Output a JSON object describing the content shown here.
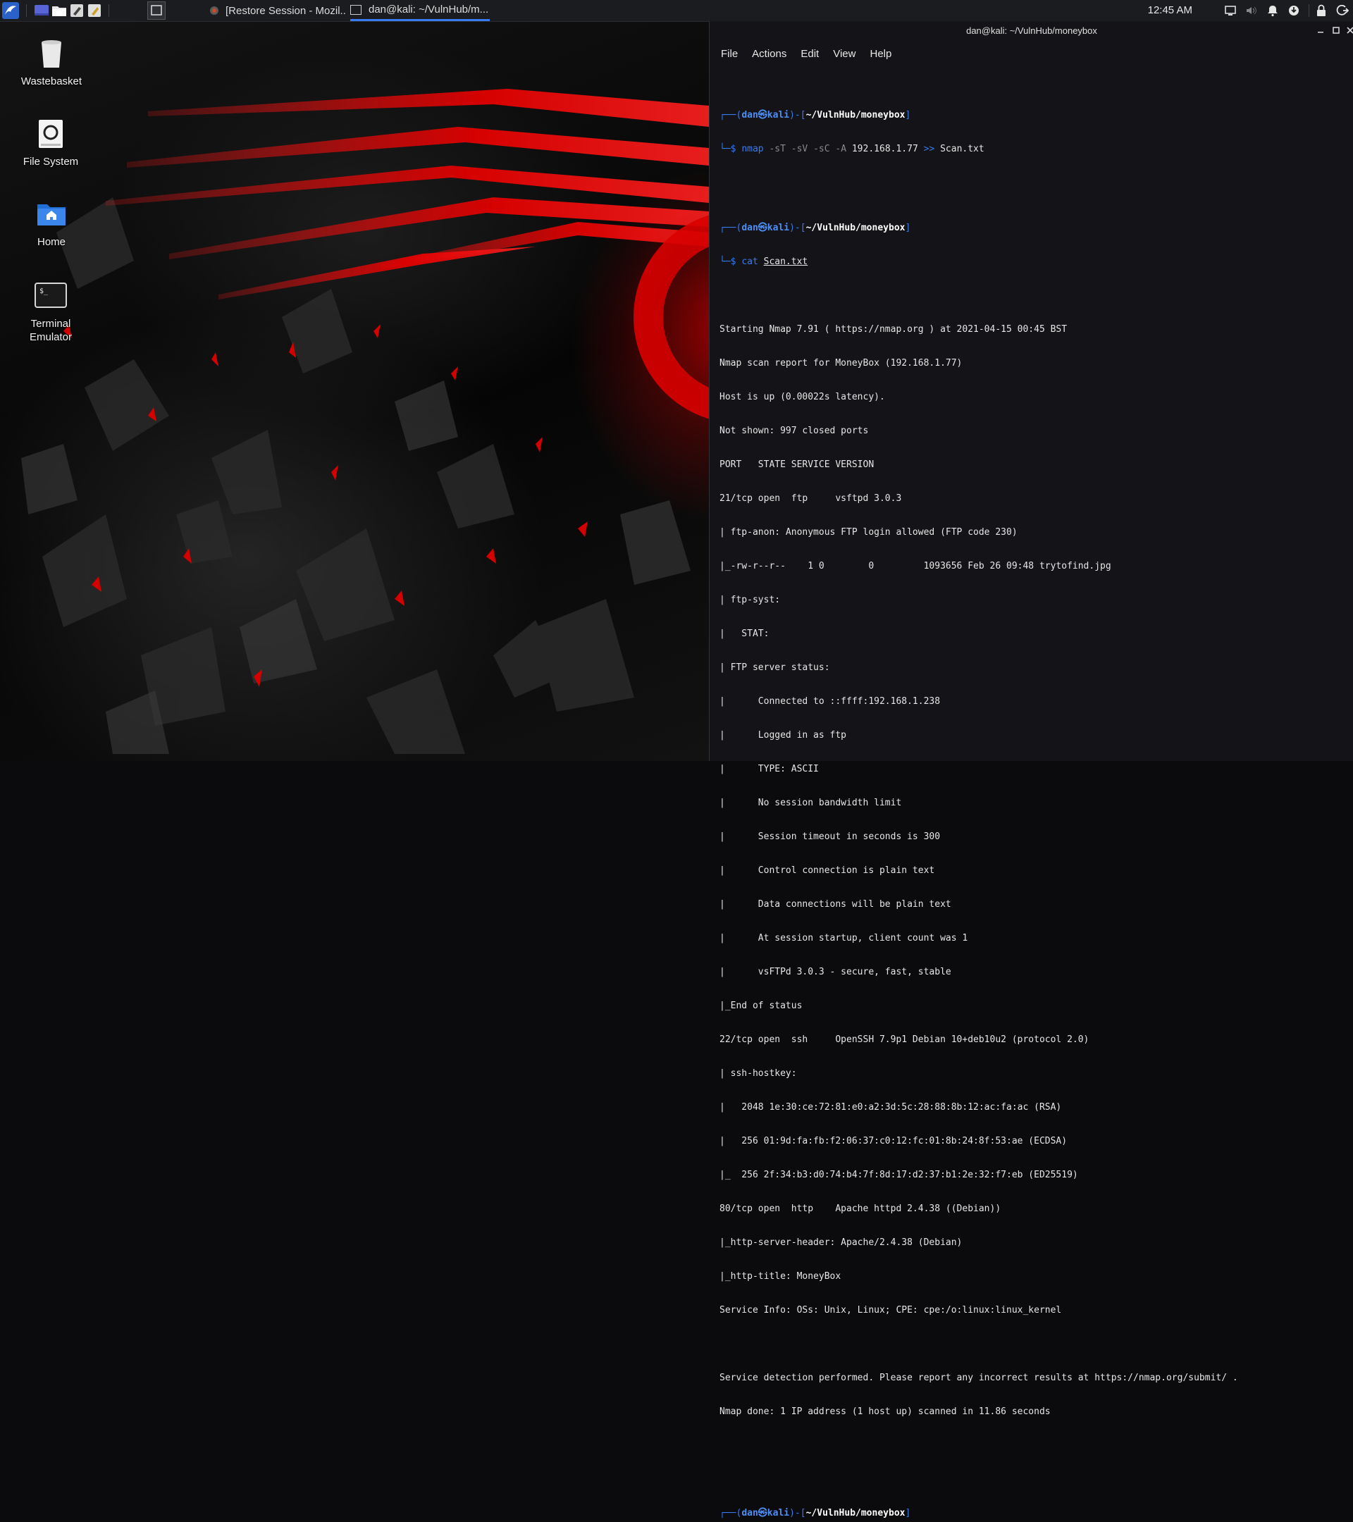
{
  "panel": {
    "tasks": [
      {
        "label": "[Restore Session - Mozil..."
      },
      {
        "label": "dan@kali: ~/VulnHub/m..."
      }
    ],
    "clock": "12:45 AM"
  },
  "desktop": {
    "icons": [
      {
        "label": "Wastebasket"
      },
      {
        "label": "File System"
      },
      {
        "label": "Home"
      },
      {
        "label": "Terminal Emulator"
      }
    ]
  },
  "terminal": {
    "title": "dan@kali: ~/VulnHub/moneybox",
    "menu": [
      "File",
      "Actions",
      "Edit",
      "View",
      "Help"
    ],
    "prompt": {
      "open": "┌──(",
      "user": "dan㉿kali",
      "mid": ")-[",
      "path": "~/VulnHub/moneybox",
      "close": "]",
      "second": "└─$ "
    },
    "cmd1": {
      "bin": "nmap",
      "opts": " -sT -sV -sC -A ",
      "args": "192.168.1.77 ",
      "redir": ">>",
      "file": " Scan.txt"
    },
    "cmd2": {
      "bin": "cat",
      "file": "Scan.txt"
    },
    "output": [
      "Starting Nmap 7.91 ( https://nmap.org ) at 2021-04-15 00:45 BST",
      "Nmap scan report for MoneyBox (192.168.1.77)",
      "Host is up (0.00022s latency).",
      "Not shown: 997 closed ports",
      "PORT   STATE SERVICE VERSION",
      "21/tcp open  ftp     vsftpd 3.0.3",
      "| ftp-anon: Anonymous FTP login allowed (FTP code 230)",
      "|_-rw-r--r--    1 0        0         1093656 Feb 26 09:48 trytofind.jpg",
      "| ftp-syst:",
      "|   STAT:",
      "| FTP server status:",
      "|      Connected to ::ffff:192.168.1.238",
      "|      Logged in as ftp",
      "|      TYPE: ASCII",
      "|      No session bandwidth limit",
      "|      Session timeout in seconds is 300",
      "|      Control connection is plain text",
      "|      Data connections will be plain text",
      "|      At session startup, client count was 1",
      "|      vsFTPd 3.0.3 - secure, fast, stable",
      "|_End of status",
      "22/tcp open  ssh     OpenSSH 7.9p1 Debian 10+deb10u2 (protocol 2.0)",
      "| ssh-hostkey:",
      "|   2048 1e:30:ce:72:81:e0:a2:3d:5c:28:88:8b:12:ac:fa:ac (RSA)",
      "|   256 01:9d:fa:fb:f2:06:37:c0:12:fc:01:8b:24:8f:53:ae (ECDSA)",
      "|_  256 2f:34:b3:d0:74:b4:7f:8d:17:d2:37:b1:2e:32:f7:eb (ED25519)",
      "80/tcp open  http    Apache httpd 2.4.38 ((Debian))",
      "|_http-server-header: Apache/2.4.38 (Debian)",
      "|_http-title: MoneyBox",
      "Service Info: OSs: Unix, Linux; CPE: cpe:/o:linux:linux_kernel",
      "",
      "Service detection performed. Please report any incorrect results at https://nmap.org/submit/ .",
      "Nmap done: 1 IP address (1 host up) scanned in 11.86 seconds"
    ]
  },
  "colors": {
    "accent": "#367bf0",
    "panel_bg": "#1b1c1f",
    "terminal_bg": "#16161a",
    "wallpaper_red": "#d40000"
  },
  "icons": {
    "menu": "kali-dragon-icon",
    "trash": "wastebasket-icon",
    "fs": "drive-icon",
    "home": "home-folder-icon",
    "term": "terminal-icon"
  }
}
